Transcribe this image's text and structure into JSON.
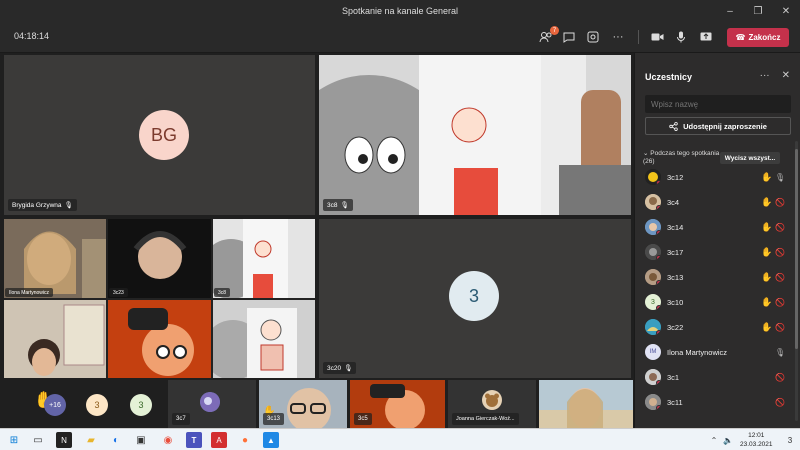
{
  "window": {
    "title": "Spotkanie na kanale General",
    "minimize": "–",
    "maximize": "❐",
    "close": "✕"
  },
  "toolbar": {
    "elapsed": "04:18:14",
    "participants_badge": "7",
    "leave_label": "Zakończ",
    "more": "···"
  },
  "stage": {
    "tiles": [
      {
        "initials": "BG",
        "name": "Brygida Grzywna"
      },
      {
        "name": "3c8"
      },
      {
        "name": "3c20",
        "initials": "3"
      }
    ],
    "grid_tiles": [
      {
        "name": "Ilona Martynowicz"
      },
      {
        "name": "3c23"
      },
      {
        "name": "3c8"
      }
    ]
  },
  "strip": {
    "hand_count": "+16",
    "avatars": [
      "3",
      "3"
    ],
    "tiles": [
      {
        "name": "3c7"
      },
      {
        "name": "3c13"
      },
      {
        "name": "3c5"
      },
      {
        "name": "Joanna Gierczak-Woź..."
      },
      {
        "name": ""
      }
    ]
  },
  "panel": {
    "title": "Uczestnicy",
    "more": "···",
    "close": "✕",
    "search_placeholder": "Wpisz nazwę",
    "share_label": "Udostępnij zaproszenie",
    "section_label": "Podczas tego spotkania",
    "section_count": "(26)",
    "mute_all": "Wycisz wszyst...",
    "participants": [
      {
        "name": "3c12",
        "hand": true,
        "mic": "on"
      },
      {
        "name": "3c4",
        "hand": true,
        "mic": "off"
      },
      {
        "name": "3c14",
        "hand": true,
        "mic": "off"
      },
      {
        "name": "3c17",
        "hand": true,
        "mic": "off"
      },
      {
        "name": "3c13",
        "hand": true,
        "mic": "off"
      },
      {
        "name": "3c10",
        "hand": true,
        "mic": "off",
        "initials": "3"
      },
      {
        "name": "3c22",
        "hand": true,
        "mic": "off"
      },
      {
        "name": "Ilona Martynowicz",
        "hand": false,
        "mic": "on",
        "initials": "IM"
      },
      {
        "name": "3c1",
        "hand": false,
        "mic": "off"
      },
      {
        "name": "3c11",
        "hand": false,
        "mic": "off"
      }
    ]
  },
  "taskbar": {
    "time": "12:01",
    "date": "23.03.2021",
    "notif_count": "3"
  },
  "colors": {
    "leave": "#c4314b",
    "accent": "#6264a7",
    "hand": "#f5c249"
  }
}
